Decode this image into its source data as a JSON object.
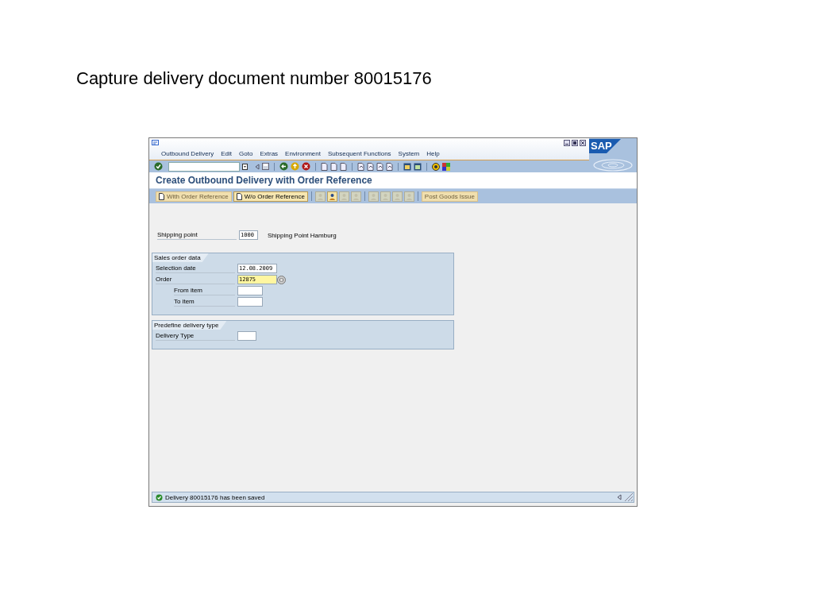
{
  "slide_title": "Capture delivery document number 80015176",
  "menu": [
    "Outbound Delivery",
    "Edit",
    "Goto",
    "Extras",
    "Environment",
    "Subsequent Functions",
    "System",
    "Help"
  ],
  "title": "Create Outbound Delivery with Order Reference",
  "app_toolbar": [
    {
      "kind": "text",
      "label": "With Order Reference",
      "disabled": true
    },
    {
      "kind": "text",
      "label": "W/o Order Reference",
      "disabled": false
    },
    {
      "kind": "separator"
    },
    {
      "kind": "icon",
      "disabled": true
    },
    {
      "kind": "icon",
      "disabled": false
    },
    {
      "kind": "icon",
      "disabled": true
    },
    {
      "kind": "icon",
      "disabled": true
    },
    {
      "kind": "separator"
    },
    {
      "kind": "icon",
      "disabled": true
    },
    {
      "kind": "icon",
      "disabled": true
    },
    {
      "kind": "icon",
      "disabled": true
    },
    {
      "kind": "icon",
      "disabled": true
    },
    {
      "kind": "separator"
    },
    {
      "kind": "text",
      "label": "Post Goods Issue",
      "disabled": true
    }
  ],
  "shipping_point": {
    "label": "Shipping point",
    "value": "1000",
    "description": "Shipping Point Hamburg"
  },
  "groups": [
    {
      "title": "Sales order data",
      "fields": [
        {
          "label": "Selection date",
          "value": "12.08.2009",
          "focused": false
        },
        {
          "label": "Order",
          "value": "12875",
          "focused": true,
          "children": [
            {
              "label": "From item",
              "focused": false
            },
            {
              "label": "To item",
              "focused": false
            }
          ]
        }
      ]
    },
    {
      "title": "Predefine delivery type",
      "fields": [
        {
          "label": "Delivery Type",
          "focused": false
        }
      ]
    }
  ],
  "logo": "SAP",
  "status": {
    "kind": "success",
    "message": "Delivery 80015176 has been saved"
  }
}
